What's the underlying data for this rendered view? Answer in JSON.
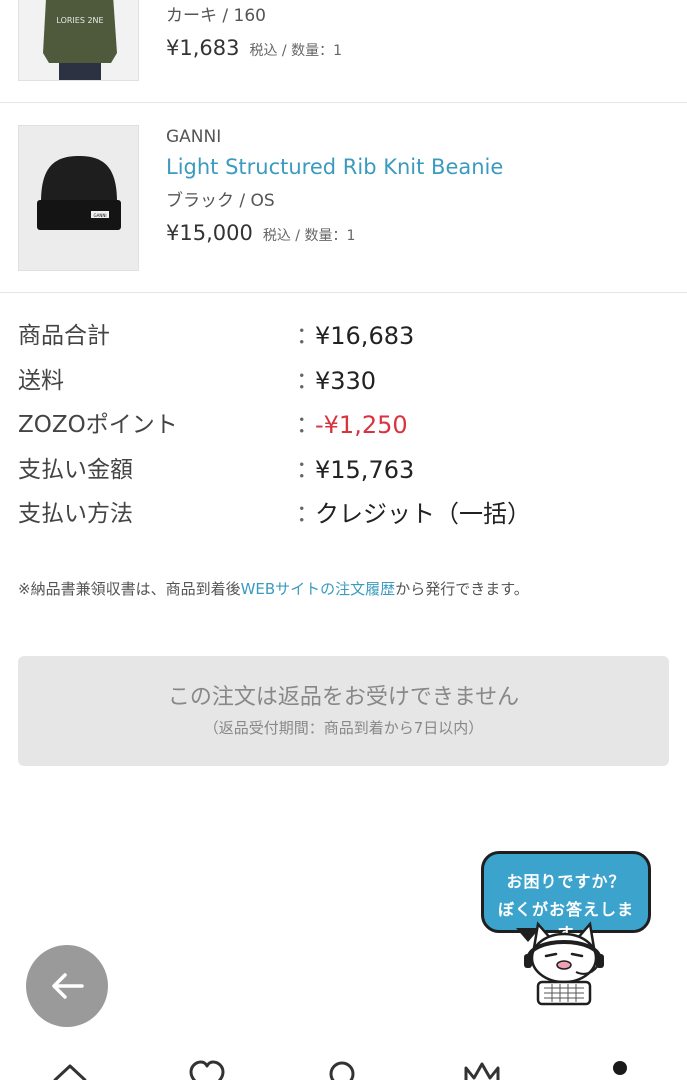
{
  "items": [
    {
      "brand": "",
      "name": "",
      "variant": "カーキ / 160",
      "price": "¥1,683",
      "tax_qty": "税込 / 数量：1",
      "thumb_text": "LORIES 2NE"
    },
    {
      "brand": "GANNI",
      "name": "Light Structured Rib Knit Beanie",
      "variant": "ブラック / OS",
      "price": "¥15,000",
      "tax_qty": "税込 / 数量：1",
      "thumb_text": "GANNI"
    }
  ],
  "summary": [
    {
      "label": "商品合計",
      "colon": "：",
      "value": "¥16,683",
      "negative": false
    },
    {
      "label": "送料",
      "colon": "：",
      "value": "¥330",
      "negative": false
    },
    {
      "label": "ZOZOポイント",
      "colon": "：",
      "value": "-¥1,250",
      "negative": true
    },
    {
      "label": "支払い金額",
      "colon": "：",
      "value": "¥15,763",
      "negative": false
    },
    {
      "label": "支払い方法",
      "colon": "：",
      "value": "クレジット（一括）",
      "negative": false
    }
  ],
  "note": {
    "prefix": "※納品書兼領収書は、商品到着後",
    "link": "WEBサイトの注文履歴",
    "suffix": "から発行できます。"
  },
  "return_notice": {
    "main": "この注文は返品をお受けできません",
    "sub": "（返品受付期間：商品到着から7日以内）"
  },
  "helper": {
    "line1": "お困りですか？",
    "line2": "ぼくがお答えします"
  },
  "back_button": {
    "icon": "arrow-left-icon"
  },
  "tabbar": [
    {
      "icon": "home-icon"
    },
    {
      "icon": "heart-icon"
    },
    {
      "icon": "search-icon"
    },
    {
      "icon": "crown-icon"
    },
    {
      "icon": "user-icon"
    }
  ],
  "colors": {
    "link": "#3a9bbf",
    "negative": "#d9333f",
    "bubble": "#3ba3cc"
  }
}
